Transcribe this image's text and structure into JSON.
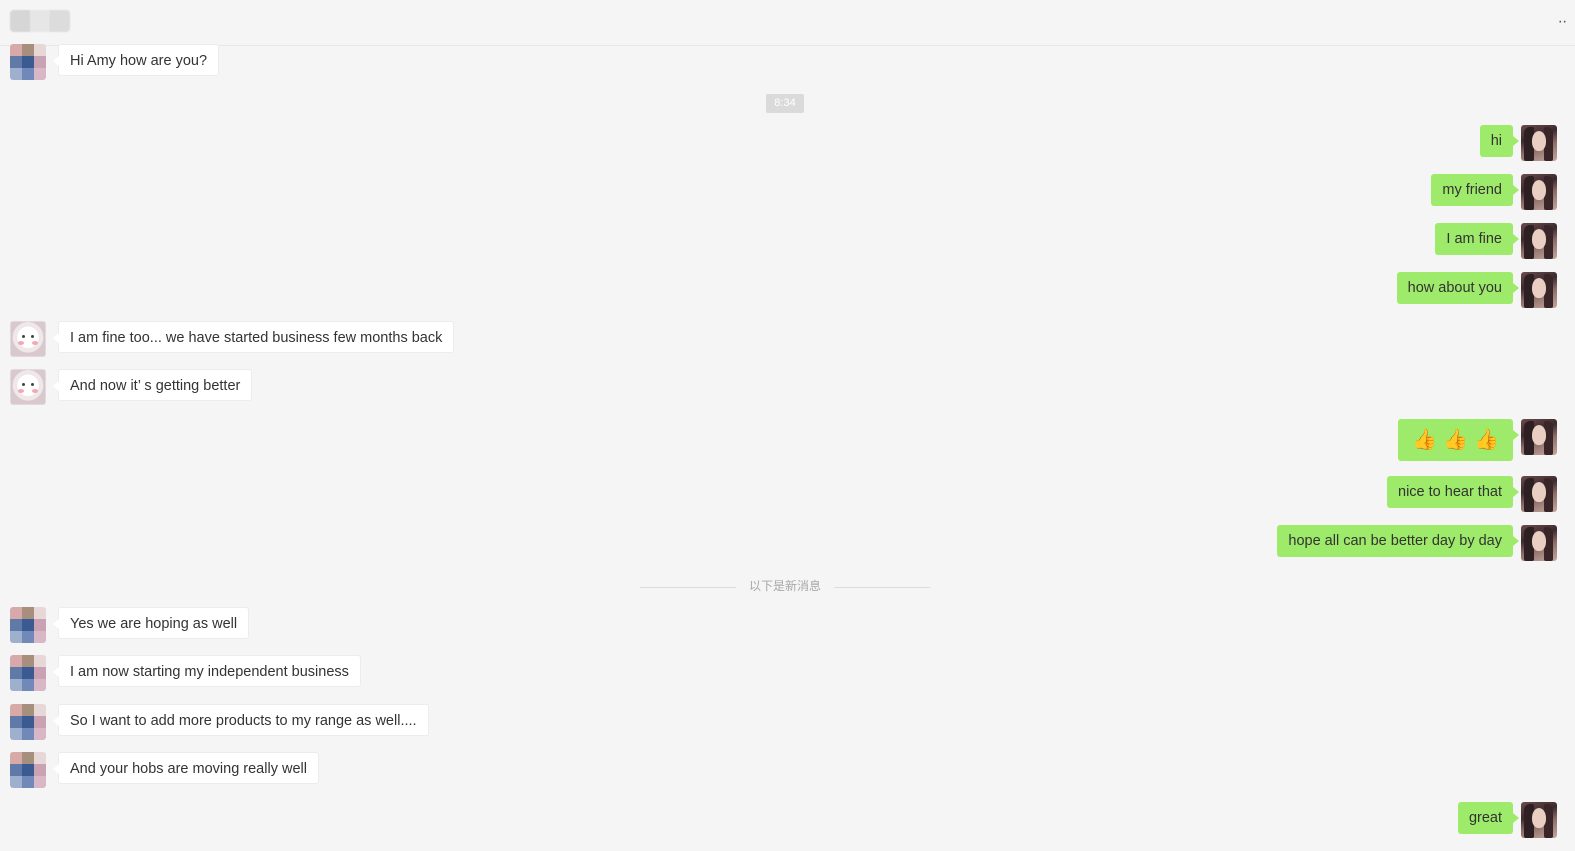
{
  "header": {
    "more_icon": "more-dots-icon",
    "more_glyph": "··"
  },
  "messages": [
    {
      "side": "left",
      "avatar": "pixelated",
      "text": "Hi Amy how are you?"
    },
    {
      "side": "right",
      "avatar": "photo",
      "text": "hi"
    },
    {
      "side": "right",
      "avatar": "photo",
      "text": "my friend"
    },
    {
      "side": "right",
      "avatar": "photo",
      "text": "I am fine"
    },
    {
      "side": "right",
      "avatar": "photo",
      "text": "how about you"
    },
    {
      "side": "left",
      "avatar": "cartoon",
      "text": "I am fine too... we have started business few months back"
    },
    {
      "side": "left",
      "avatar": "cartoon",
      "text": "And now it’ s getting better"
    },
    {
      "side": "right",
      "avatar": "photo",
      "text": "👍👍👍"
    },
    {
      "side": "right",
      "avatar": "photo",
      "text": "nice to hear that"
    },
    {
      "side": "right",
      "avatar": "photo",
      "text": "hope all can be better day by day"
    },
    {
      "side": "left",
      "avatar": "pixelated",
      "text": "Yes we are hoping as well"
    },
    {
      "side": "left",
      "avatar": "pixelated",
      "text": "I am now starting my independent business"
    },
    {
      "side": "left",
      "avatar": "pixelated",
      "text": "So I want to add more products to my range as well...."
    },
    {
      "side": "left",
      "avatar": "pixelated",
      "text": "And your hobs are moving really well"
    },
    {
      "side": "right",
      "avatar": "photo",
      "text": "great"
    }
  ],
  "timestamp": "8:34",
  "new_messages_divider": "以下是新消息",
  "colors": {
    "background": "#f5f5f5",
    "sent_bubble": "#9eea6a",
    "received_bubble": "#ffffff",
    "timestamp_bg": "#dadada"
  }
}
